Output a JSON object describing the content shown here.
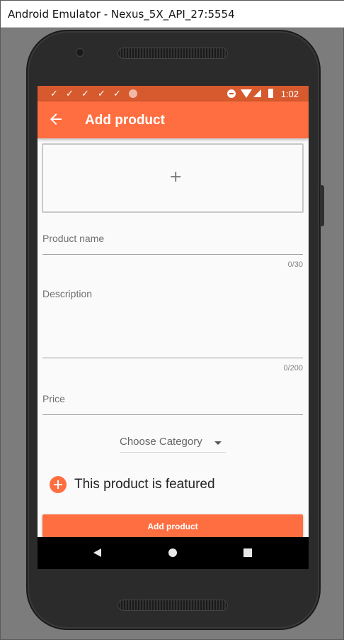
{
  "window": {
    "title": "Android Emulator - Nexus_5X_API_27:5554"
  },
  "status_bar": {
    "time": "1:02",
    "notification_icons": [
      "check-icon",
      "check-icon",
      "check-icon",
      "check-icon",
      "check-icon",
      "record-dot-icon"
    ],
    "system_icons": [
      "do-not-disturb-icon",
      "wifi-icon",
      "signal-icon",
      "battery-icon"
    ]
  },
  "app_bar": {
    "title": "Add product",
    "nav_icon": "arrow-back-icon"
  },
  "form": {
    "image_picker": {
      "icon": "add-icon",
      "symbol": "+"
    },
    "product_name": {
      "placeholder": "Product name",
      "counter": "0/30"
    },
    "description": {
      "placeholder": "Description",
      "counter": "0/200"
    },
    "price": {
      "placeholder": "Price"
    },
    "category": {
      "label": "Choose Category",
      "icon": "dropdown-caret-icon"
    },
    "featured": {
      "label": "This product is featured",
      "icon": "add-circle-icon"
    },
    "submit_label": "Add product"
  },
  "nav_bar": {
    "buttons": [
      "back-triangle-icon",
      "home-circle-icon",
      "recents-square-icon"
    ]
  },
  "colors": {
    "accent": "#ff6e40",
    "status_bar": "#d75a2e",
    "background": "#fafafa"
  }
}
